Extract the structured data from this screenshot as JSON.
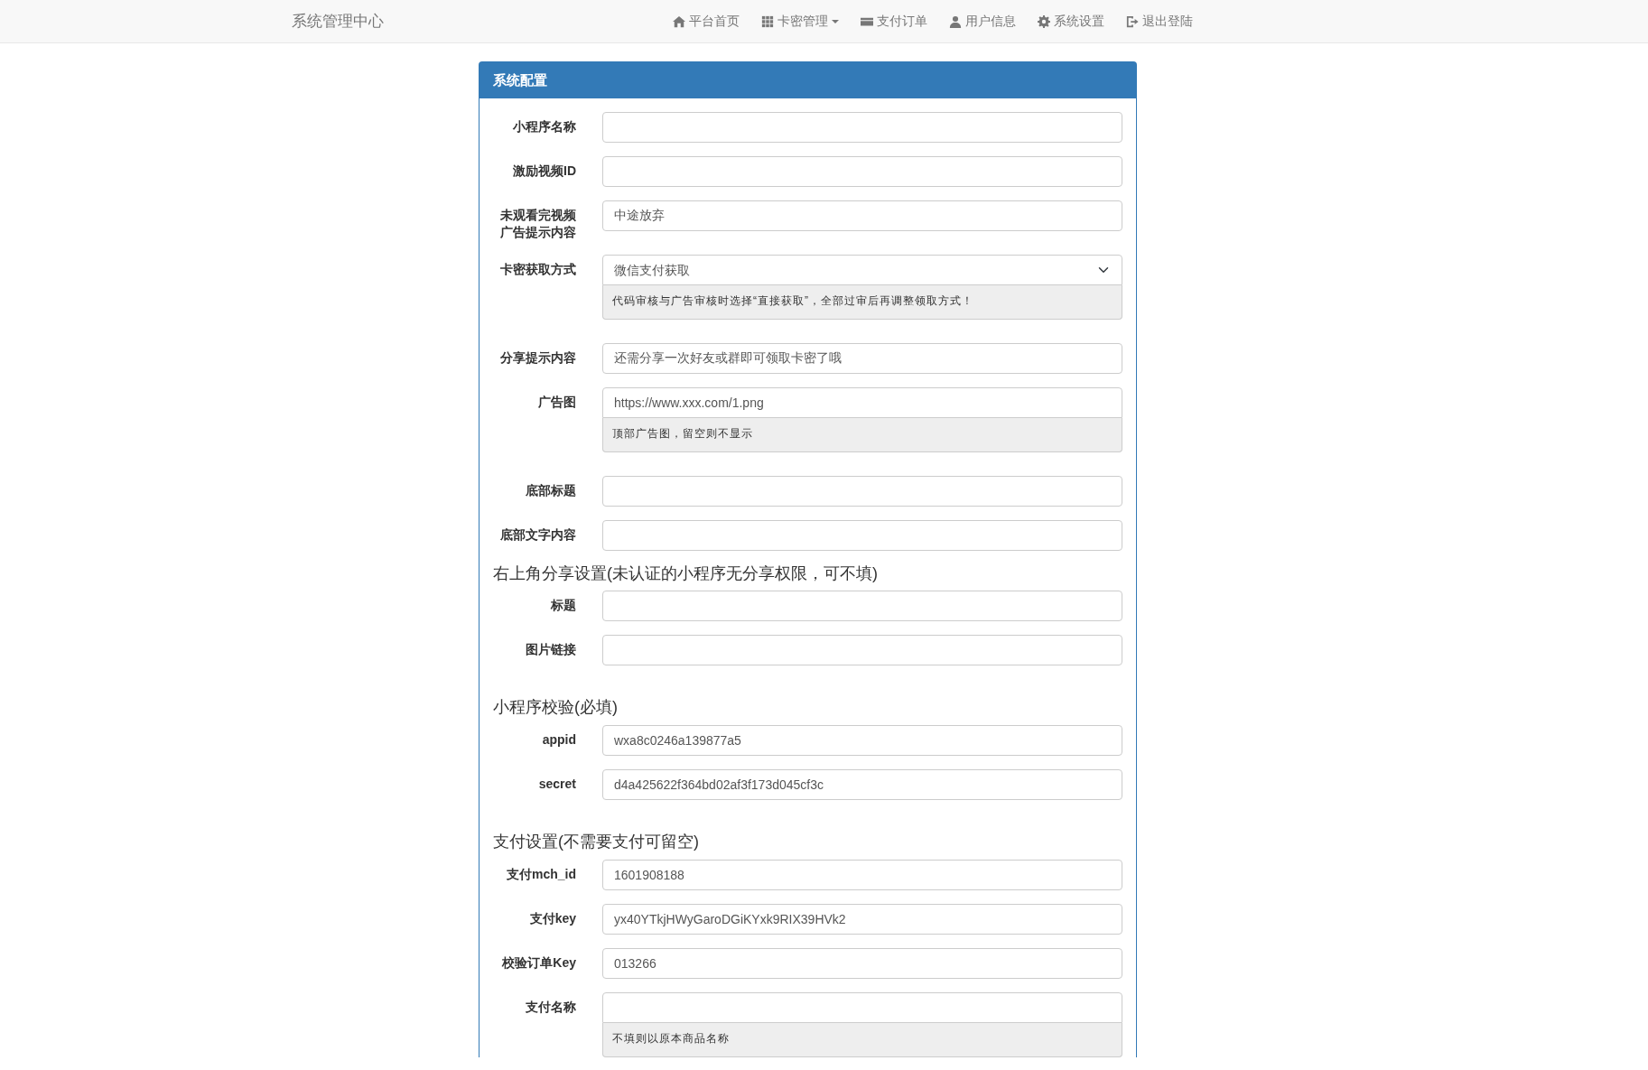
{
  "navbar": {
    "brand": "系统管理中心",
    "items": [
      {
        "label": "平台首页",
        "dropdown": false
      },
      {
        "label": "卡密管理",
        "dropdown": true
      },
      {
        "label": "支付订单",
        "dropdown": false
      },
      {
        "label": "用户信息",
        "dropdown": false
      },
      {
        "label": "系统设置",
        "dropdown": false
      },
      {
        "label": "退出登陆",
        "dropdown": false
      }
    ]
  },
  "panel": {
    "title": "系统配置",
    "groups": [
      {
        "fields": [
          {
            "kind": "input",
            "label": "小程序名称"
          },
          {
            "kind": "input",
            "label": "激励视频ID"
          },
          {
            "kind": "input",
            "label": "未观看完视频广告提示内容",
            "value": "中途放弃"
          },
          {
            "kind": "select",
            "label": "卡密获取方式",
            "value": "微信支付获取",
            "help": "代码审核与广告审核时选择“直接获取”，全部过审后再调整领取方式！"
          },
          {
            "kind": "input",
            "label": "分享提示内容",
            "value": "还需分享一次好友或群即可领取卡密了哦"
          },
          {
            "kind": "input",
            "label": "广告图",
            "value": "https://www.xxx.com/1.png",
            "help": "顶部广告图，留空则不显示"
          },
          {
            "kind": "input",
            "label": "底部标题"
          },
          {
            "kind": "input",
            "label": "底部文字内容"
          }
        ]
      },
      {
        "heading": "右上角分享设置(未认证的小程序无分享权限，可不填)",
        "fields": [
          {
            "kind": "input",
            "label": "标题"
          },
          {
            "kind": "input",
            "label": "图片链接"
          }
        ]
      },
      {
        "heading": "小程序校验(必填)",
        "fields": [
          {
            "kind": "input",
            "label": "appid",
            "value": "wxa8c0246a139877a5"
          },
          {
            "kind": "input",
            "label": "secret",
            "value": "d4a425622f364bd02af3f173d045cf3c"
          }
        ]
      },
      {
        "heading": "支付设置(不需要支付可留空)",
        "fields": [
          {
            "kind": "input",
            "label": "支付mch_id",
            "value": "1601908188"
          },
          {
            "kind": "input",
            "label": "支付key",
            "value": "yx40YTkjHWyGaroDGiKYxk9RIX39HVk2"
          },
          {
            "kind": "input",
            "label": "校验订单Key",
            "value": "013266"
          },
          {
            "kind": "input",
            "label": "支付名称",
            "help": "不填则以原本商品名称"
          }
        ]
      }
    ]
  }
}
